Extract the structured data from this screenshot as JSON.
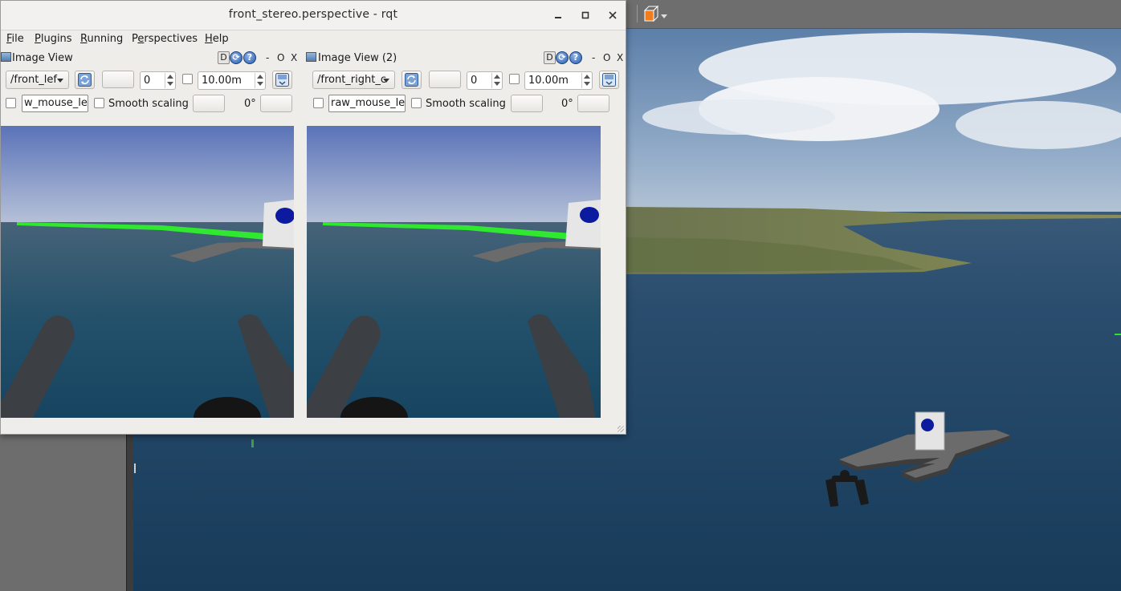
{
  "window": {
    "title": "front_stereo.perspective - rqt",
    "minimize_icon": "minimize-icon",
    "maximize_icon": "maximize-icon",
    "close_icon": "close-icon"
  },
  "menubar": {
    "items": [
      {
        "label": "File",
        "mnemonic": "F"
      },
      {
        "label": "Plugins",
        "mnemonic": "P"
      },
      {
        "label": "Running",
        "mnemonic": "R"
      },
      {
        "label": "Perspectives",
        "mnemonic": "e"
      },
      {
        "label": "Help",
        "mnemonic": "H"
      }
    ]
  },
  "panes": [
    {
      "title": "Image View",
      "header_buttons": {
        "d": "D",
        "minus": "-",
        "o": "O",
        "x": "X"
      },
      "topic": "/front_lef",
      "rotation_value": "0",
      "max_range": "10.00m",
      "mouse_topic": "w_mouse_left",
      "smooth_scaling": "Smooth scaling",
      "rotation_label": "0°",
      "camera": "left"
    },
    {
      "title": "Image View (2)",
      "header_buttons": {
        "d": "D",
        "minus": "-",
        "o": "O",
        "x": "X"
      },
      "topic": "/front_right_c",
      "rotation_value": "0",
      "max_range": "10.00m",
      "mouse_topic": "raw_mouse_left",
      "smooth_scaling": "Smooth scaling",
      "rotation_label": "0°",
      "camera": "right"
    }
  ],
  "gazebo": {
    "toolbar_icons": [
      "box-icon",
      "dropdown-arrow-icon"
    ],
    "accent_orange": "#f07c1e",
    "sky": "#6d8fb4",
    "water": "#1f4664"
  }
}
